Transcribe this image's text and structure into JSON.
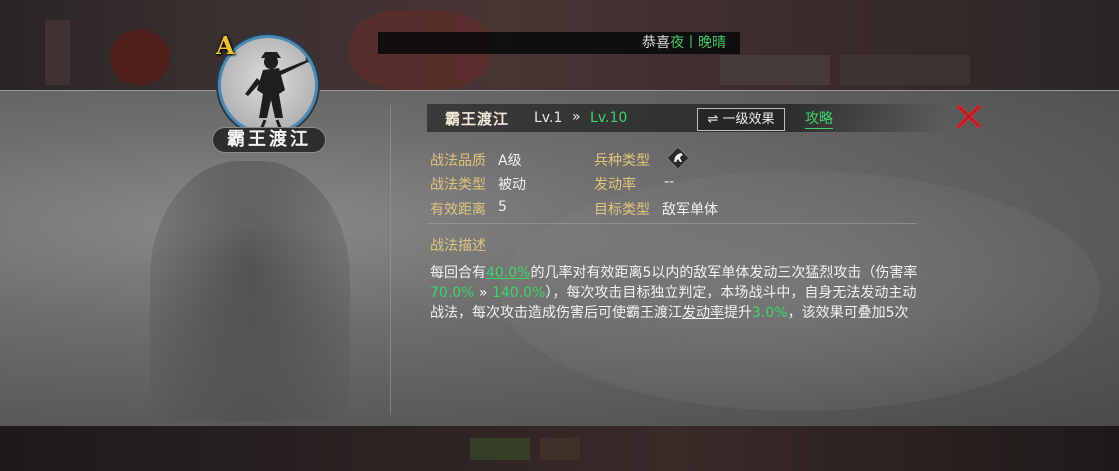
{
  "notice": {
    "prefix": "恭喜",
    "name": "夜丨晚晴",
    "rest": "",
    "prefix_color": "#e8e8e8",
    "name_color": "#46d46a"
  },
  "skill": {
    "grade": "A",
    "portrait_name": "霸王渡江",
    "name": "霸王渡江",
    "level_current": "Lv.1",
    "level_arrow": "»",
    "level_max": "Lv.10",
    "effect_button": "⇌ 一级效果",
    "guide_link": "攻略"
  },
  "attributes": {
    "quality_label": "战法品质",
    "quality_value": "A级",
    "troop_label": "兵种类型",
    "troop_icon": "horse-icon",
    "type_label": "战法类型",
    "type_value": "被动",
    "rate_label": "发动率",
    "rate_value": "--",
    "range_label": "有效距离",
    "range_value": "5",
    "target_label": "目标类型",
    "target_value": "敌军单体"
  },
  "description": {
    "title": "战法描述",
    "t1": "每回合有",
    "v1": "40.0%",
    "t2": "的几率对有效距离5以内的敌军单体发动三次猛烈攻击（伤害率",
    "v2": "70.0%",
    "arrow": " » ",
    "v3": "140.0%",
    "t3": "），每次攻击目标独立判定，本场战斗中，自身无法发动主动战法，每次攻击造成伤害后可使霸王渡江",
    "u1": "发动率",
    "t4": "提升",
    "v4": "3.0%",
    "t5": "，该效果可叠加5次"
  },
  "colors": {
    "accent_green": "#3cd46a",
    "label_gold": "#e0c47a",
    "grade_gold": "#f0c030",
    "close_red": "#d8262a",
    "portrait_ring": "#4a8ab4"
  },
  "icons": {
    "close": "close-icon",
    "swap": "swap-icon"
  }
}
